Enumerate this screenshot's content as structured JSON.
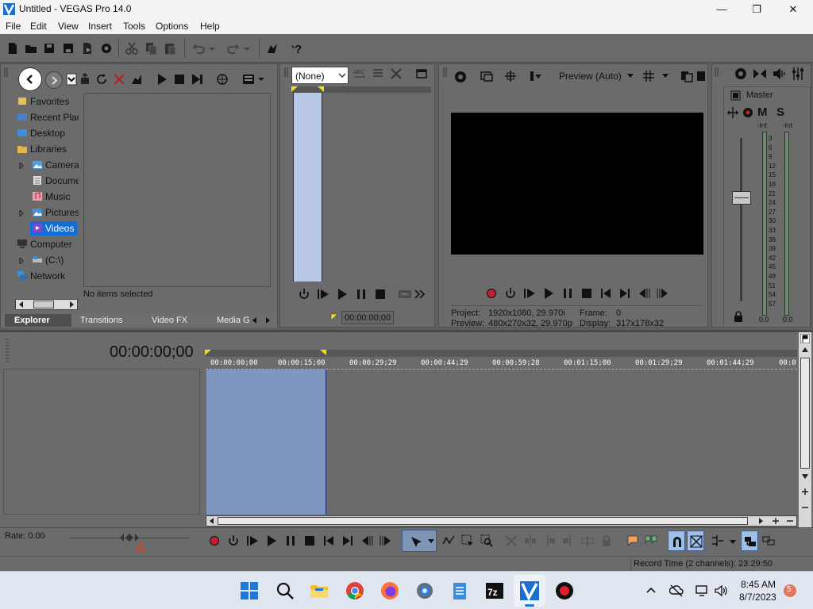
{
  "window": {
    "title": "Untitled - VEGAS Pro 14.0",
    "minimize_glyph": "—",
    "maximize_glyph": "❐",
    "close_glyph": "✕"
  },
  "menu": {
    "items": [
      "File",
      "Edit",
      "View",
      "Insert",
      "Tools",
      "Options",
      "Help"
    ]
  },
  "explorer": {
    "tree": [
      {
        "label": "Favorites",
        "icon": "star-icon"
      },
      {
        "label": "Recent Plac",
        "icon": "recent-icon"
      },
      {
        "label": "Desktop",
        "icon": "desktop-icon"
      },
      {
        "label": "Libraries",
        "icon": "folder-icon"
      },
      {
        "label": "Camera",
        "icon": "camera-icon"
      },
      {
        "label": "Docume",
        "icon": "document-icon"
      },
      {
        "label": "Music",
        "icon": "music-icon"
      },
      {
        "label": "Pictures",
        "icon": "pictures-icon"
      },
      {
        "label": "Videos",
        "icon": "videos-icon"
      },
      {
        "label": "Computer",
        "icon": "computer-icon"
      },
      {
        "label": "(C:\\)",
        "icon": "drive-icon"
      },
      {
        "label": "Network",
        "icon": "network-icon"
      }
    ],
    "status": "No items selected",
    "tabs": [
      "Explorer",
      "Transitions",
      "Video FX",
      "Media G"
    ]
  },
  "trimmer": {
    "dropdown_value": "(None)",
    "timecode": "00:00:00;00"
  },
  "preview": {
    "mode_label": "Preview (Auto)",
    "project_label": "Project:",
    "project_value": "1920x1080, 29.970i",
    "preview_label": "Preview:",
    "preview_value": "480x270x32, 29.970p",
    "frame_label": "Frame:",
    "frame_value": "0",
    "display_label": "Display:",
    "display_value": "317x178x32"
  },
  "mixer": {
    "master_label": "Master",
    "m_label": "M",
    "s_label": "S",
    "inf_left": "-Inf.",
    "inf_right": "-Inf.",
    "scale": [
      "3",
      "6",
      "9",
      "12",
      "15",
      "18",
      "21",
      "24",
      "27",
      "30",
      "33",
      "36",
      "39",
      "42",
      "45",
      "48",
      "51",
      "54",
      "57"
    ],
    "level_left": "0.0",
    "level_right": "0.0"
  },
  "timeline": {
    "cursor_time": "00:00:00;00",
    "ruler": [
      "00:00:00;00",
      "00:00:15;00",
      "00:00:29;29",
      "00:00:44;29",
      "00:00:59;28",
      "00:01:15;00",
      "00:01:29;29",
      "00:01:44;29",
      "00:0"
    ],
    "rate_label": "Rate: 0.00",
    "record_time": "Record Time (2 channels): 23:29:50"
  },
  "taskbar": {
    "time": "8:45 AM",
    "date": "8/7/2023",
    "notification_count": "5"
  }
}
